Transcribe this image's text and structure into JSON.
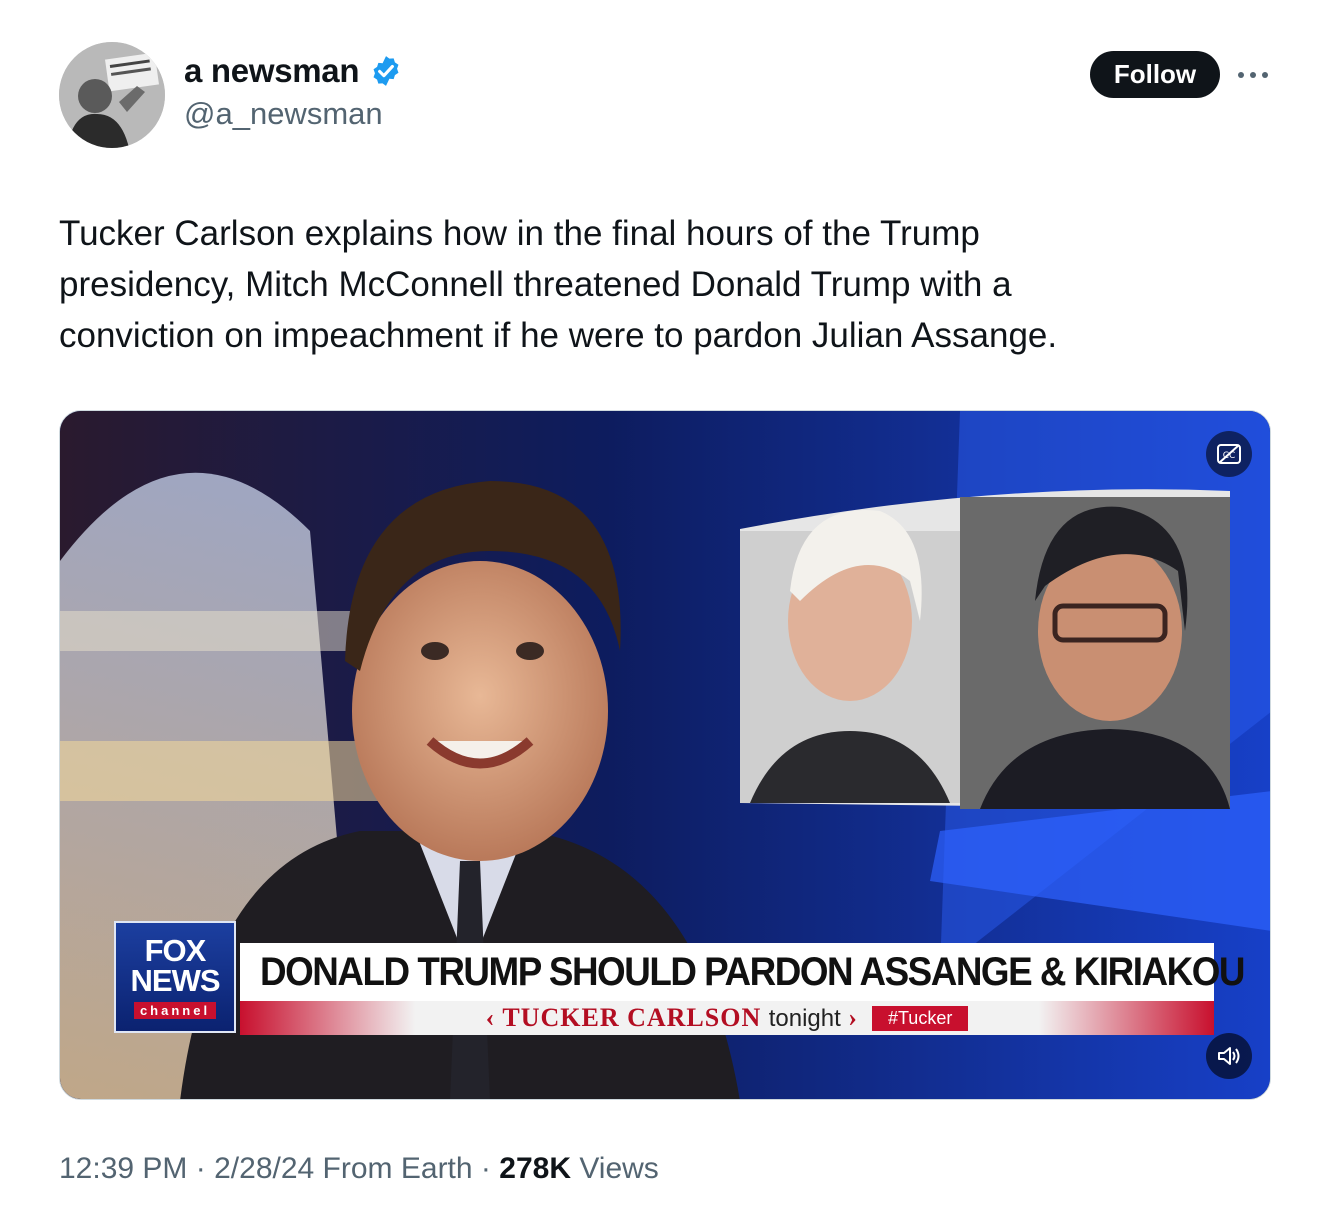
{
  "author": {
    "display_name": "a newsman",
    "handle": "@a_newsman",
    "verified": true,
    "verified_color": "#1d9bf0"
  },
  "actions": {
    "follow_label": "Follow",
    "more_icon": "more-dots-icon"
  },
  "tweet": {
    "text": "Tucker Carlson explains how in the final hours of the Trump\npresidency, Mitch McConnell threatened Donald Trump with a\nconviction on impeachment if he were to pardon Julian Assange."
  },
  "video": {
    "network_logo_top": "FOX",
    "network_logo_mid": "NEWS",
    "network_logo_bottom": "channel",
    "headline": "DONALD TRUMP SHOULD PARDON ASSANGE & KIRIAKOU",
    "show_prefix": "TUCKER CARLSON",
    "show_suffix": "tonight",
    "hashtag": "#Tucker",
    "captions_icon": "captions-off-icon",
    "volume_icon": "volume-icon"
  },
  "meta": {
    "time": "12:39 PM",
    "date": "2/28/24",
    "source": "From Earth",
    "views_count": "278K",
    "views_label": "Views",
    "separator": "·"
  }
}
